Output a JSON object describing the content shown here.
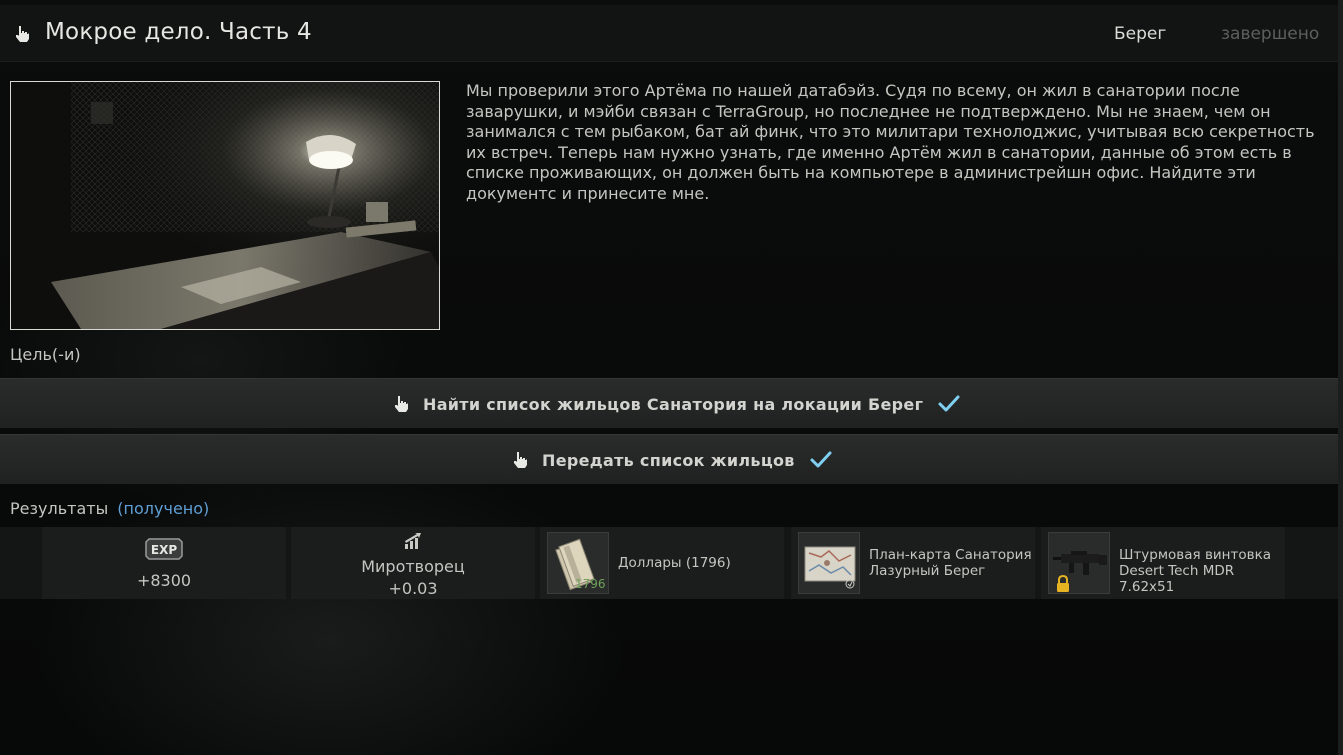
{
  "header": {
    "title": "Мокрое дело. Часть 4",
    "location": "Берег",
    "status": "завершено"
  },
  "quest": {
    "description": "Мы проверили этого Артёма по нашей датабэйз. Судя по всему, он жил в санатории после заварушки, и мэйби связан с TerraGroup, но последнее не подтверждено. Мы не знаем, чем он занимался с тем рыбаком, бат ай финк, что это милитари технолоджис, учитывая всю секретность их встреч. Теперь нам нужно узнать, где именно Артём жил в санатории, данные об этом есть в списке проживающих, он должен быть на компьютере в администрейшн офис. Найдите эти документс и принесите мне."
  },
  "goals": {
    "label": "Цель(-и)",
    "items": [
      {
        "text": "Найти список жильцов Санатория на локации Берег",
        "completed": true
      },
      {
        "text": "Передать список жильцов",
        "completed": true
      }
    ]
  },
  "results": {
    "label": "Результаты",
    "status": "(получено)",
    "rewards": [
      {
        "type": "exp",
        "badge": "EXP",
        "value": "+8300"
      },
      {
        "type": "reputation",
        "trader": "Миротворец",
        "value": "+0.03"
      },
      {
        "type": "item",
        "name": "Доллары (1796)",
        "count": "1796"
      },
      {
        "type": "item",
        "name_line1": "План-карта Санатория",
        "name_line2": "Лазурный Берег"
      },
      {
        "type": "item",
        "name_line1": "Штурмовая винтовка",
        "name_line2": "Desert Tech MDR 7.62x51",
        "locked": true
      }
    ]
  },
  "colors": {
    "accent_blue": "#5f9fd4",
    "check_blue": "#7fd0f0",
    "stack_green": "#6ea35a",
    "lock_gold": "#e6b422"
  },
  "icons": {
    "quest": "hand-pointer-icon",
    "check": "checkmark-icon",
    "exp": "exp-badge-icon",
    "trader": "trader-rank-icon",
    "lock": "lock-icon"
  }
}
